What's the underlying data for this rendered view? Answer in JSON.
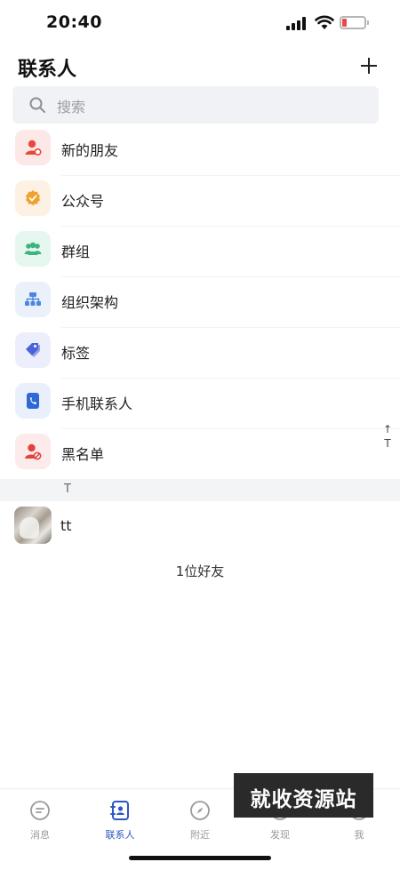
{
  "status_bar": {
    "time": "20:40",
    "battery_level": 0.2
  },
  "header": {
    "title": "联系人",
    "add_icon": "plus-icon"
  },
  "search": {
    "placeholder": "搜索",
    "icon": "search-icon"
  },
  "menu": [
    {
      "label": "新的朋友",
      "icon": "new-friend-icon",
      "bg": "#fde8e8",
      "color": "#e8473c"
    },
    {
      "label": "公众号",
      "icon": "official-account-icon",
      "bg": "#fdf1e3",
      "color": "#f0a32c"
    },
    {
      "label": "群组",
      "icon": "group-icon",
      "bg": "#e5f7ef",
      "color": "#3cb57c"
    },
    {
      "label": "组织架构",
      "icon": "org-chart-icon",
      "bg": "#eaf1fb",
      "color": "#4c86df"
    },
    {
      "label": "标签",
      "icon": "tag-icon",
      "bg": "#eceefb",
      "color": "#4a63d8"
    },
    {
      "label": "手机联系人",
      "icon": "phone-contacts-icon",
      "bg": "#eaf0fb",
      "color": "#2e67d6"
    },
    {
      "label": "黑名单",
      "icon": "blacklist-icon",
      "bg": "#fdeaea",
      "color": "#e0443c"
    }
  ],
  "index_bar": {
    "arrow": "↑",
    "letter": "T"
  },
  "sections": [
    {
      "letter": "T",
      "contacts": [
        {
          "name": "tt",
          "avatar": "photo-avatar"
        }
      ]
    }
  ],
  "footer": {
    "friend_count": "1位好友"
  },
  "tab_bar": [
    {
      "label": "消息",
      "icon": "message-icon",
      "active": false
    },
    {
      "label": "联系人",
      "icon": "contacts-icon",
      "active": true
    },
    {
      "label": "附近",
      "icon": "compass-icon",
      "active": false
    },
    {
      "label": "发现",
      "icon": "discover-icon",
      "active": false
    },
    {
      "label": "我",
      "icon": "profile-icon",
      "active": false
    }
  ],
  "watermark": {
    "text": "就收资源站"
  },
  "colors": {
    "accent": "#2b59c3",
    "tab_inactive": "#9a9a9a",
    "section_bg": "#f3f4f6"
  }
}
